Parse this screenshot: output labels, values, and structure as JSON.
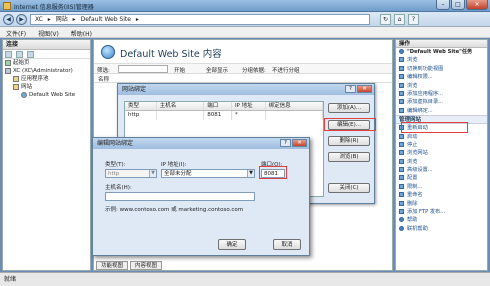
{
  "window": {
    "title": "Internet 信息服务(IIS)管理器"
  },
  "address": {
    "segments": [
      "XC",
      "▸",
      "网站",
      "▸",
      "Default Web Site",
      "▸"
    ]
  },
  "menu": [
    "文件(F)",
    "视图(V)",
    "帮助(H)"
  ],
  "connections": {
    "title": "连接",
    "tree": [
      {
        "label": "起始页",
        "indent": 0
      },
      {
        "label": "XC (XC\\Administrator)",
        "indent": 0
      },
      {
        "label": "应用程序池",
        "indent": 1
      },
      {
        "label": "网站",
        "indent": 1
      },
      {
        "label": "Default Web Site",
        "indent": 2
      }
    ]
  },
  "center": {
    "heading": "Default Web Site 内容",
    "filter_label": "筛选:",
    "go_label": "开始",
    "show_all_label": "全部显示",
    "group_label": "分组依据:",
    "group_value": "不进行分组",
    "col_name": "名称",
    "view_tabs": [
      "功能视图",
      "内容视图"
    ]
  },
  "actions": {
    "title": "操作",
    "items": [
      {
        "label": "\"Default Web Site\"任务",
        "kind": "ti"
      },
      {
        "label": "浏览",
        "kind": ""
      },
      {
        "label": "切换到功能视图",
        "kind": ""
      },
      {
        "label": "编辑权限...",
        "kind": ""
      },
      {
        "label": "浏览",
        "kind": ""
      },
      {
        "label": "添加应用程序...",
        "kind": ""
      },
      {
        "label": "添加虚拟目录...",
        "kind": ""
      },
      {
        "label": "编辑绑定...",
        "kind": ""
      }
    ],
    "manage_section": "管理网站",
    "manage_items": [
      {
        "label": "重新启动",
        "kind": ""
      },
      {
        "label": "启动",
        "kind": ""
      },
      {
        "label": "停止",
        "kind": ""
      },
      {
        "label": "浏览网站",
        "kind": ""
      },
      {
        "label": "浏览",
        "kind": ""
      },
      {
        "label": "高级设置...",
        "kind": ""
      },
      {
        "label": "配置",
        "kind": ""
      },
      {
        "label": "限制...",
        "kind": ""
      },
      {
        "label": "重命名",
        "kind": ""
      },
      {
        "label": "删除",
        "kind": ""
      },
      {
        "label": "添加 FTP 发布...",
        "kind": ""
      },
      {
        "label": "帮助",
        "kind": "help"
      },
      {
        "label": "联机帮助",
        "kind": "help"
      }
    ]
  },
  "status": "就绪",
  "bindings_dialog": {
    "title": "网站绑定",
    "columns": [
      "类型",
      "主机名",
      "端口",
      "IP 地址",
      "绑定信息"
    ],
    "rows": [
      {
        "type": "http",
        "host": "",
        "port": "8081",
        "ip": "*",
        "info": ""
      }
    ],
    "buttons": {
      "add": "添加(A)...",
      "edit": "编辑(E)...",
      "remove": "删除(R)",
      "browse": "浏览(B)",
      "close": "关闭(C)"
    }
  },
  "edit_dialog": {
    "title": "编辑网站绑定",
    "type_label": "类型(T):",
    "type_value": "http",
    "ip_label": "IP 地址(I):",
    "ip_value": "全部未分配",
    "port_label": "端口(O):",
    "port_value": "8081",
    "host_label": "主机名(H):",
    "host_value": "",
    "example": "示例: www.contoso.com 或 marketing.contoso.com",
    "ok": "确定",
    "cancel": "取消"
  }
}
